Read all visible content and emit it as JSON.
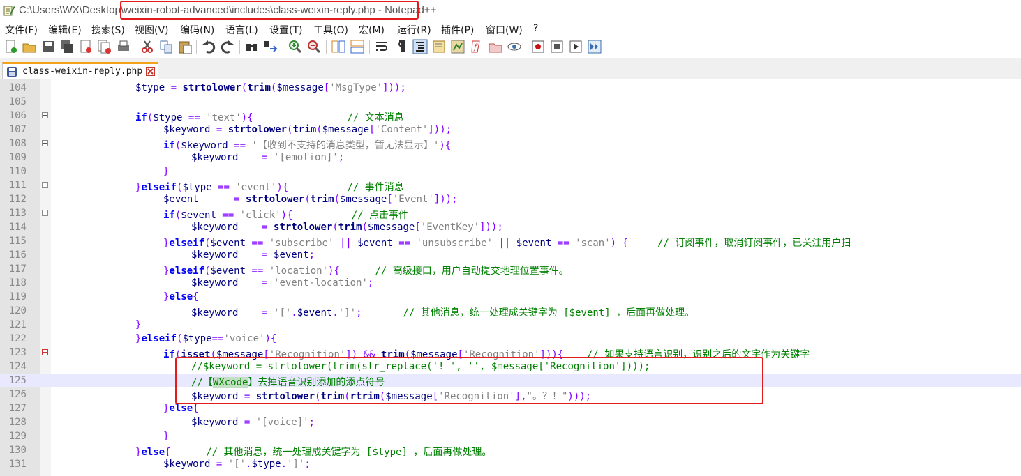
{
  "window": {
    "title_path_prefix": "C:\\Users\\WX\\Desktop\\",
    "title_path_highlighted": "weixin-robot-advanced\\includes\\class-weixin-reply.php",
    "title_app": " - Notepad++"
  },
  "menu": [
    {
      "label": "文件(F)"
    },
    {
      "label": "编辑(E)"
    },
    {
      "label": "搜索(S)"
    },
    {
      "label": "视图(V)"
    },
    {
      "label": "编码(N)"
    },
    {
      "label": "语言(L)"
    },
    {
      "label": "设置(T)"
    },
    {
      "label": "工具(O)"
    },
    {
      "label": "宏(M)"
    },
    {
      "label": "运行(R)"
    },
    {
      "label": "插件(P)"
    },
    {
      "label": "窗口(W)"
    },
    {
      "label": "?"
    }
  ],
  "toolbar": [
    "new-file-icon",
    "open-file-icon",
    "save-icon",
    "save-all-icon",
    "close-icon",
    "close-all-icon",
    "print-icon",
    "cut-icon",
    "copy-icon",
    "paste-icon",
    "undo-icon",
    "redo-icon",
    "find-icon",
    "replace-icon",
    "zoom-in-icon",
    "zoom-out-icon",
    "sync-v-icon",
    "sync-h-icon",
    "word-wrap-icon",
    "show-all-chars-icon",
    "indent-guide-icon",
    "doc-map-icon",
    "function-list-icon",
    "folder-workspace-icon",
    "monitoring-icon",
    "record-macro-icon",
    "stop-record-icon",
    "play-macro-icon",
    "run-macro-multiple-icon",
    "save-macro-icon"
  ],
  "tab": {
    "label": "class-weixin-reply.php"
  },
  "colors": {
    "highlight_border": "#e21b1b",
    "keyword": "#0000ff",
    "string": "#808080",
    "comment": "#008000",
    "current_line": "#e8e8ff"
  },
  "lines": [
    {
      "n": "104",
      "t": [
        [
          "$type",
          "var"
        ],
        [
          " = ",
          "op"
        ],
        [
          "strtolower",
          "fn"
        ],
        [
          "(",
          "br"
        ],
        [
          "trim",
          "fn"
        ],
        [
          "(",
          "br"
        ],
        [
          "$message",
          "var"
        ],
        [
          "[",
          "br"
        ],
        [
          "'MsgType'",
          "str"
        ],
        [
          "]));",
          "br"
        ]
      ]
    },
    {
      "n": "105",
      "t": []
    },
    {
      "n": "106",
      "t": [
        [
          "if",
          "kw"
        ],
        [
          "(",
          "br"
        ],
        [
          "$type",
          "var"
        ],
        [
          " == ",
          "op"
        ],
        [
          "'text'",
          "str"
        ],
        [
          "){",
          "br"
        ],
        [
          "                ",
          ""
        ],
        [
          "// 文本消息",
          "cmt"
        ]
      ]
    },
    {
      "n": "107",
      "t": [
        [
          "$keyword",
          "var"
        ],
        [
          " = ",
          "op"
        ],
        [
          "strtolower",
          "fn"
        ],
        [
          "(",
          "br"
        ],
        [
          "trim",
          "fn"
        ],
        [
          "(",
          "br"
        ],
        [
          "$message",
          "var"
        ],
        [
          "[",
          "br"
        ],
        [
          "'Content'",
          "str"
        ],
        [
          "]));",
          "br"
        ]
      ]
    },
    {
      "n": "108",
      "t": [
        [
          "if",
          "kw"
        ],
        [
          "(",
          "br"
        ],
        [
          "$keyword",
          "var"
        ],
        [
          " == ",
          "op"
        ],
        [
          "'【收到不支持的消息类型，暂无法显示】'",
          "str"
        ],
        [
          "){",
          "br"
        ]
      ]
    },
    {
      "n": "109",
      "t": [
        [
          "$keyword",
          "var"
        ],
        [
          "    = ",
          "op"
        ],
        [
          "'[emotion]'",
          "str"
        ],
        [
          ";",
          "op"
        ]
      ]
    },
    {
      "n": "110",
      "t": [
        [
          "}",
          "br"
        ]
      ]
    },
    {
      "n": "111",
      "t": [
        [
          "}",
          "br"
        ],
        [
          "elseif",
          "kw"
        ],
        [
          "(",
          "br"
        ],
        [
          "$type",
          "var"
        ],
        [
          " == ",
          "op"
        ],
        [
          "'event'",
          "str"
        ],
        [
          "){",
          "br"
        ],
        [
          "          ",
          ""
        ],
        [
          "// 事件消息",
          "cmt"
        ]
      ]
    },
    {
      "n": "112",
      "t": [
        [
          "$event",
          "var"
        ],
        [
          "      = ",
          "op"
        ],
        [
          "strtolower",
          "fn"
        ],
        [
          "(",
          "br"
        ],
        [
          "trim",
          "fn"
        ],
        [
          "(",
          "br"
        ],
        [
          "$message",
          "var"
        ],
        [
          "[",
          "br"
        ],
        [
          "'Event'",
          "str"
        ],
        [
          "]));",
          "br"
        ]
      ]
    },
    {
      "n": "113",
      "t": [
        [
          "if",
          "kw"
        ],
        [
          "(",
          "br"
        ],
        [
          "$event",
          "var"
        ],
        [
          " == ",
          "op"
        ],
        [
          "'click'",
          "str"
        ],
        [
          "){",
          "br"
        ],
        [
          "          ",
          ""
        ],
        [
          "// 点击事件",
          "cmt"
        ]
      ]
    },
    {
      "n": "114",
      "t": [
        [
          "$keyword",
          "var"
        ],
        [
          "    = ",
          "op"
        ],
        [
          "strtolower",
          "fn"
        ],
        [
          "(",
          "br"
        ],
        [
          "trim",
          "fn"
        ],
        [
          "(",
          "br"
        ],
        [
          "$message",
          "var"
        ],
        [
          "[",
          "br"
        ],
        [
          "'EventKey'",
          "str"
        ],
        [
          "]));",
          "br"
        ]
      ]
    },
    {
      "n": "115",
      "t": [
        [
          "}",
          "br"
        ],
        [
          "elseif",
          "kw"
        ],
        [
          "(",
          "br"
        ],
        [
          "$event",
          "var"
        ],
        [
          " == ",
          "op"
        ],
        [
          "'subscribe'",
          "str"
        ],
        [
          " || ",
          "op"
        ],
        [
          "$event",
          "var"
        ],
        [
          " == ",
          "op"
        ],
        [
          "'unsubscribe'",
          "str"
        ],
        [
          " || ",
          "op"
        ],
        [
          "$event",
          "var"
        ],
        [
          " == ",
          "op"
        ],
        [
          "'scan'",
          "str"
        ],
        [
          ") {",
          "br"
        ],
        [
          "     ",
          ""
        ],
        [
          "// 订阅事件，取消订阅事件，已关注用户扫",
          "cmt"
        ]
      ]
    },
    {
      "n": "116",
      "t": [
        [
          "$keyword",
          "var"
        ],
        [
          "    = ",
          "op"
        ],
        [
          "$event",
          "var"
        ],
        [
          ";",
          "op"
        ]
      ]
    },
    {
      "n": "117",
      "t": [
        [
          "}",
          "br"
        ],
        [
          "elseif",
          "kw"
        ],
        [
          "(",
          "br"
        ],
        [
          "$event",
          "var"
        ],
        [
          " == ",
          "op"
        ],
        [
          "'location'",
          "str"
        ],
        [
          "){",
          "br"
        ],
        [
          "      ",
          ""
        ],
        [
          "// 高级接口，用户自动提交地理位置事件。",
          "cmt"
        ]
      ]
    },
    {
      "n": "118",
      "t": [
        [
          "$keyword",
          "var"
        ],
        [
          "    = ",
          "op"
        ],
        [
          "'event-location'",
          "str"
        ],
        [
          ";",
          "op"
        ]
      ]
    },
    {
      "n": "119",
      "t": [
        [
          "}",
          "br"
        ],
        [
          "else",
          "kw"
        ],
        [
          "{",
          "br"
        ]
      ]
    },
    {
      "n": "120",
      "t": [
        [
          "$keyword",
          "var"
        ],
        [
          "    = ",
          "op"
        ],
        [
          "'['",
          "str"
        ],
        [
          ".",
          "op"
        ],
        [
          "$event",
          "var"
        ],
        [
          ".",
          "op"
        ],
        [
          "']'",
          "str"
        ],
        [
          ";",
          "op"
        ],
        [
          "       ",
          ""
        ],
        [
          "// 其他消息，统一处理成关键字为 [$event] ，后面再做处理。",
          "cmt"
        ]
      ]
    },
    {
      "n": "121",
      "t": [
        [
          "}",
          "br"
        ]
      ]
    },
    {
      "n": "122",
      "t": [
        [
          "}",
          "br"
        ],
        [
          "elseif",
          "kw"
        ],
        [
          "(",
          "br"
        ],
        [
          "$type",
          "var"
        ],
        [
          "==",
          "op"
        ],
        [
          "'voice'",
          "str"
        ],
        [
          "){",
          "br"
        ]
      ]
    },
    {
      "n": "123",
      "t": [
        [
          "if",
          "kw"
        ],
        [
          "(",
          "br"
        ],
        [
          "isset",
          "fn"
        ],
        [
          "(",
          "br"
        ],
        [
          "$message",
          "var"
        ],
        [
          "[",
          "br"
        ],
        [
          "'Recognition'",
          "str"
        ],
        [
          "])",
          "br"
        ],
        [
          " && ",
          "op"
        ],
        [
          "trim",
          "fn"
        ],
        [
          "(",
          "br"
        ],
        [
          "$message",
          "var"
        ],
        [
          "[",
          "br"
        ],
        [
          "'Recognition'",
          "str"
        ],
        [
          "])){",
          "br"
        ],
        [
          "    ",
          ""
        ],
        [
          "// 如果支持语言识别，识别之后的文字作为关键字",
          "cmt"
        ]
      ]
    },
    {
      "n": "124",
      "t": [
        [
          "//$keyword = strtolower(trim(str_replace('! ', '', $message['Recognition'])));",
          "cmt"
        ]
      ]
    },
    {
      "n": "125",
      "t": [
        [
          "//【",
          "cmt"
        ],
        [
          "WXcode",
          "cmt hl"
        ],
        [
          "】去掉语音识别添加的添点符号",
          "cmt"
        ]
      ]
    },
    {
      "n": "126",
      "t": [
        [
          "$keyword",
          "var"
        ],
        [
          " = ",
          "op"
        ],
        [
          "strtolower",
          "fn"
        ],
        [
          "(",
          "br"
        ],
        [
          "trim",
          "fn"
        ],
        [
          "(",
          "br"
        ],
        [
          "rtrim",
          "fn"
        ],
        [
          "(",
          "br"
        ],
        [
          "$message",
          "var"
        ],
        [
          "[",
          "br"
        ],
        [
          "'Recognition'",
          "str"
        ],
        [
          "],",
          "br"
        ],
        [
          "\"。？！\"",
          "str"
        ],
        [
          ")));",
          "br"
        ]
      ]
    },
    {
      "n": "127",
      "t": [
        [
          "}",
          "br"
        ],
        [
          "else",
          "kw"
        ],
        [
          "{",
          "br"
        ]
      ]
    },
    {
      "n": "128",
      "t": [
        [
          "$keyword",
          "var"
        ],
        [
          " = ",
          "op"
        ],
        [
          "'[voice]'",
          "str"
        ],
        [
          ";",
          "op"
        ]
      ]
    },
    {
      "n": "129",
      "t": [
        [
          "}",
          "br"
        ]
      ]
    },
    {
      "n": "130",
      "t": [
        [
          "}",
          "br"
        ],
        [
          "else",
          "kw"
        ],
        [
          "{",
          "br"
        ],
        [
          "      ",
          ""
        ],
        [
          "// 其他消息，统一处理成关键字为 [$type] ，后面再做处理。",
          "cmt"
        ]
      ]
    },
    {
      "n": "131",
      "t": [
        [
          "$keyword",
          "var"
        ],
        [
          " = ",
          "op"
        ],
        [
          "'['",
          "str"
        ],
        [
          ".",
          "op"
        ],
        [
          "$type",
          "var"
        ],
        [
          ".",
          "op"
        ],
        [
          "']'",
          "str"
        ],
        [
          ";",
          "op"
        ]
      ]
    }
  ]
}
